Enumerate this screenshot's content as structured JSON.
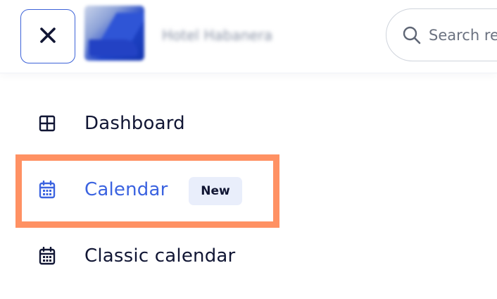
{
  "header": {
    "hotel_name": "Hotel Habanera",
    "search": {
      "placeholder": "Search re",
      "value": ""
    },
    "icons": {
      "close": "close-icon",
      "search": "search-icon"
    }
  },
  "nav": {
    "items": [
      {
        "label": "Dashboard",
        "icon": "grid-icon",
        "active": false
      },
      {
        "label": "Calendar",
        "icon": "calendar-icon",
        "active": true,
        "badge": "New"
      },
      {
        "label": "Classic calendar",
        "icon": "calendar-icon",
        "active": false
      }
    ]
  },
  "colors": {
    "accent": "#3b63e0",
    "text": "#111634",
    "badge_bg": "#e9eefb",
    "highlight": "#ff9163",
    "border": "#cfd4dc"
  }
}
